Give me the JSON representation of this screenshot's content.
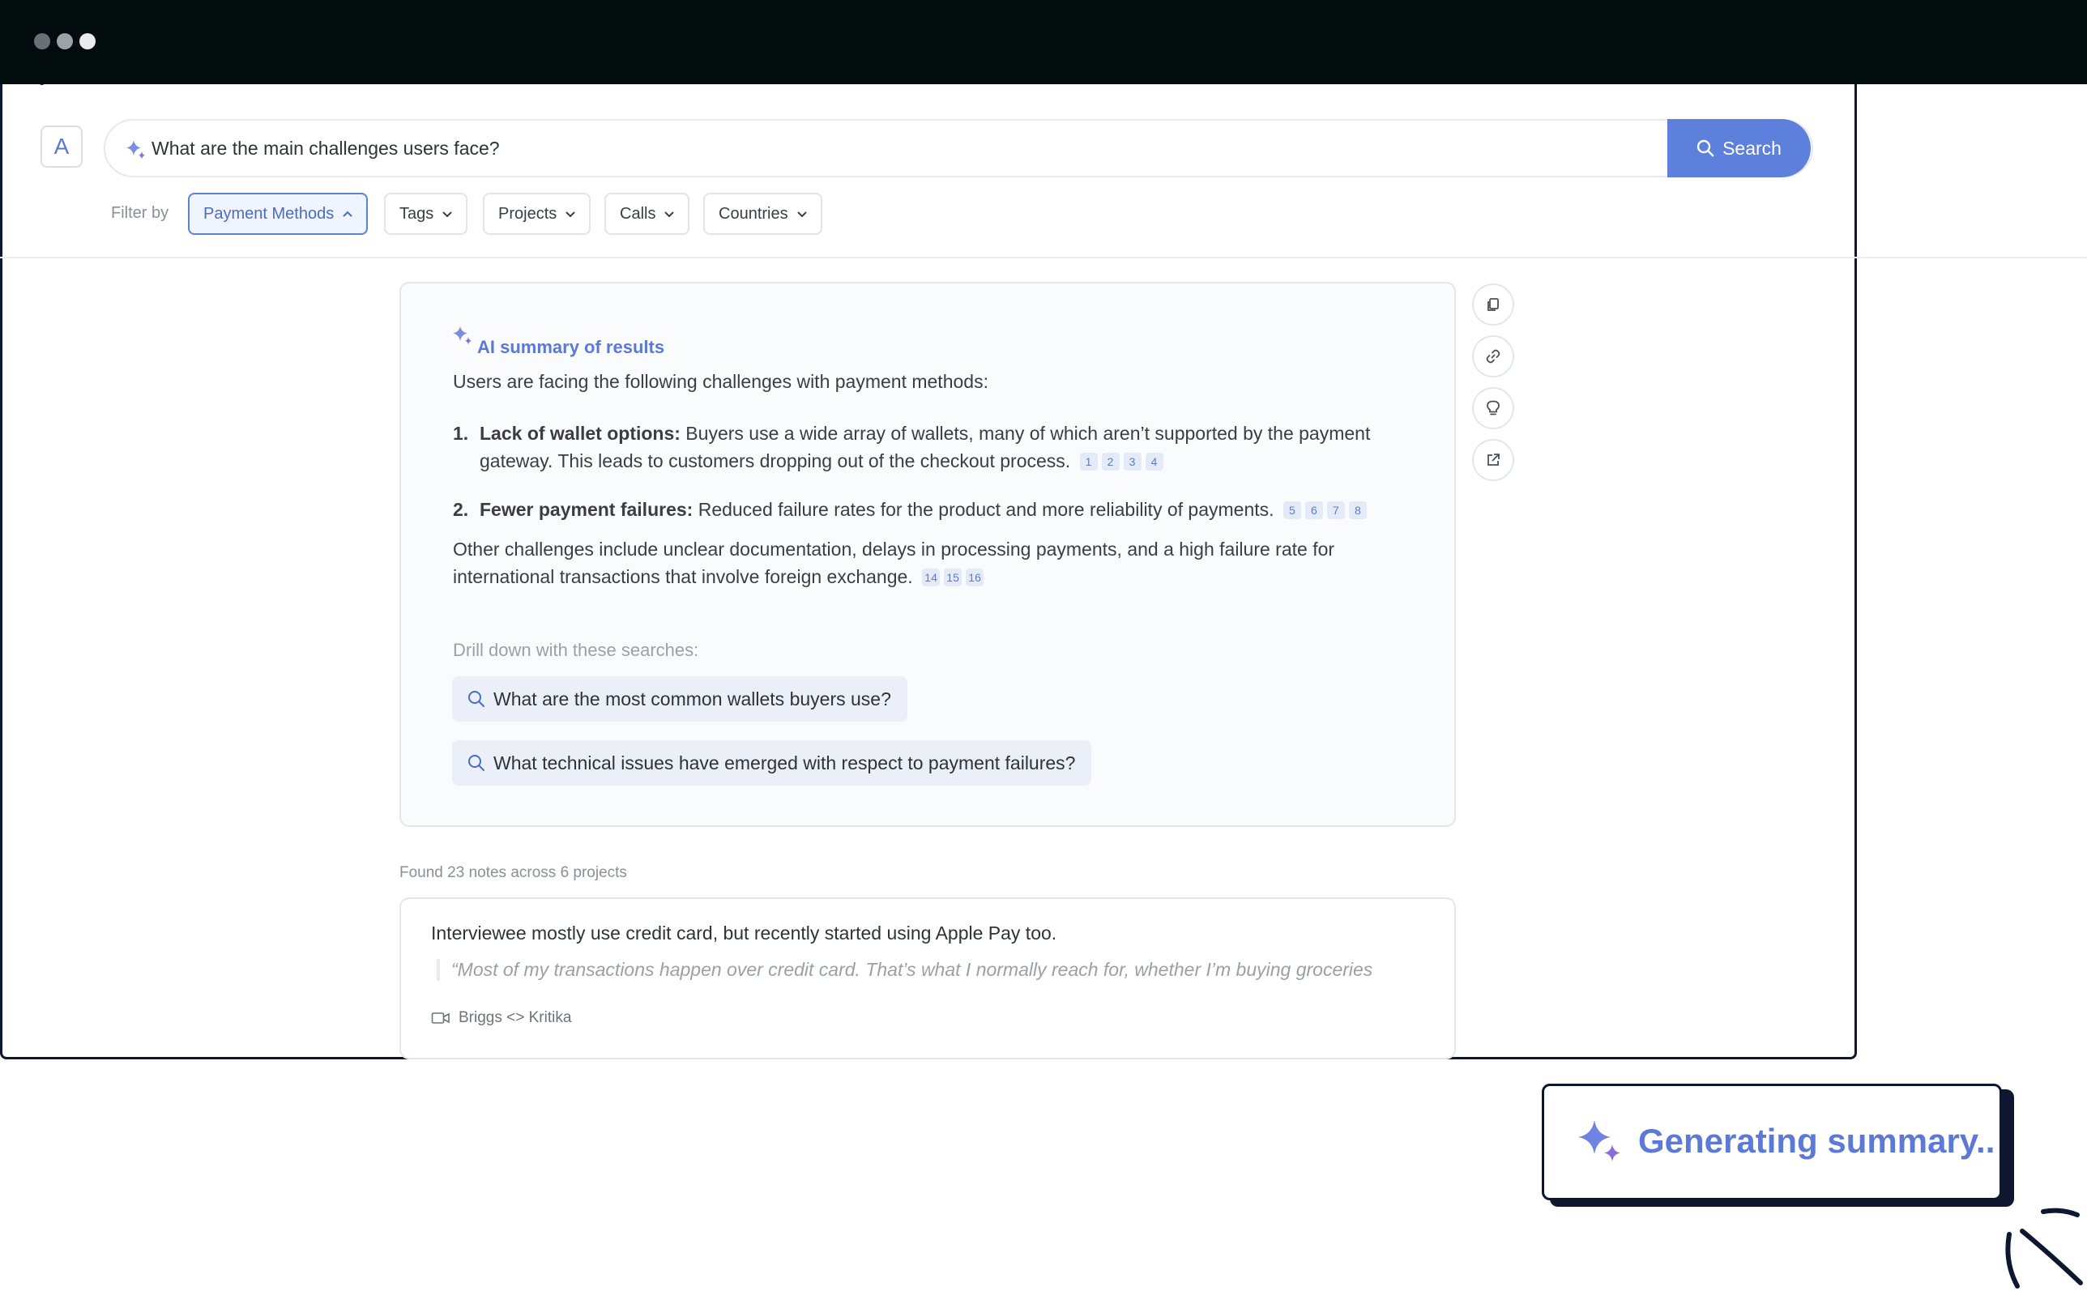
{
  "search": {
    "avatar_letter": "A",
    "query": "What are the main challenges users face?",
    "button_label": "Search"
  },
  "filters": {
    "label": "Filter by",
    "items": [
      {
        "label": "Payment Methods",
        "active": true
      },
      {
        "label": "Tags",
        "active": false
      },
      {
        "label": "Projects",
        "active": false
      },
      {
        "label": "Calls",
        "active": false
      },
      {
        "label": "Countries",
        "active": false
      }
    ]
  },
  "summary": {
    "title": "AI summary of results",
    "intro": "Users are facing the following challenges with payment methods:",
    "items": [
      {
        "num": "1.",
        "bold": "Lack of wallet options:",
        "text": " Buyers use a wide array of wallets, many of which aren’t supported by the payment gateway. This leads to customers dropping out of the checkout process.",
        "cites": [
          "1",
          "2",
          "3",
          "4"
        ]
      },
      {
        "num": "2.",
        "bold": "Fewer payment failures:",
        "text": " Reduced failure rates for the product and more reliability of payments.",
        "cites": [
          "5",
          "6",
          "7",
          "8"
        ]
      }
    ],
    "other": "Other challenges include unclear documentation, delays in processing payments, and a high failure rate for international transactions that involve foreign exchange.",
    "other_cites": [
      "14",
      "15",
      "16"
    ],
    "drill_label": "Drill down with these searches:",
    "drill_searches": [
      "What are the most common wallets buyers use?",
      "What technical issues have emerged with respect to payment failures?"
    ]
  },
  "actions": [
    "copy-icon",
    "link-icon",
    "lightbulb-icon",
    "external-link-icon"
  ],
  "results": {
    "found_text": "Found 23 notes across 6 projects",
    "note": {
      "title": "Interviewee mostly use credit card, but recently started using Apple Pay too.",
      "quote": "“Most of my transactions happen over credit card. That’s what I normally reach for, whether I’m buying groceries",
      "call": "Briggs <> Kritika"
    }
  },
  "toast": {
    "text": "Generating summary.."
  },
  "colors": {
    "accent": "#5d80dc",
    "titlebar": "#040d0e",
    "frame": "#0d1830"
  }
}
